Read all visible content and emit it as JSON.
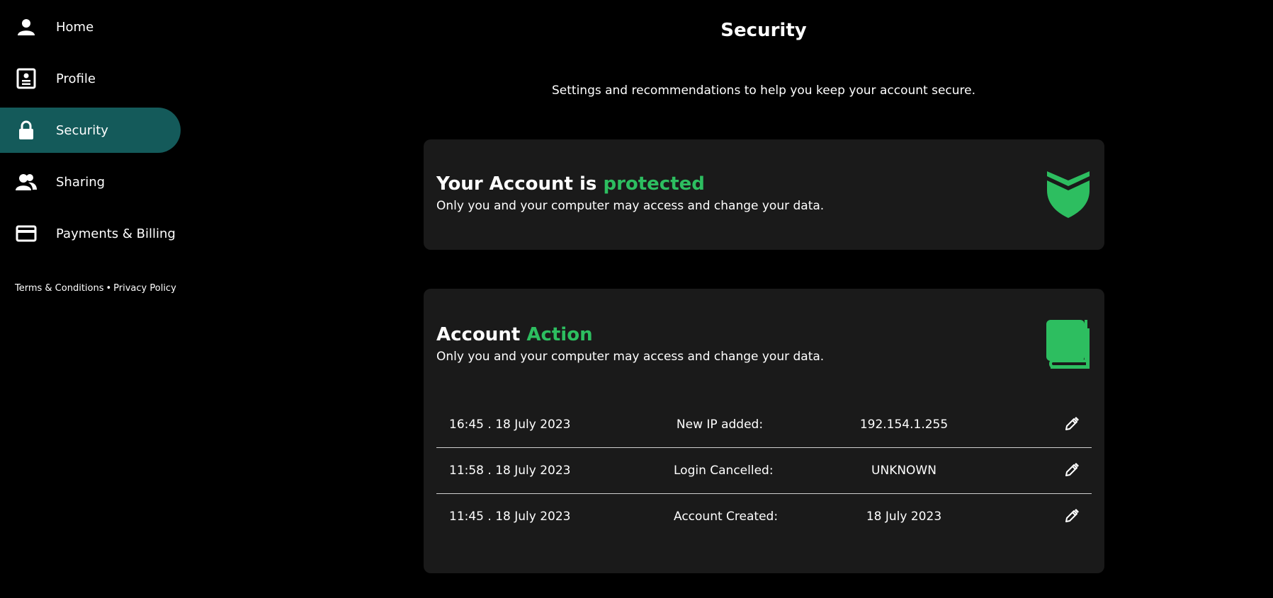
{
  "sidebar": {
    "items": [
      {
        "label": "Home",
        "icon": "user-icon",
        "active": false
      },
      {
        "label": "Profile",
        "icon": "profile-card-icon",
        "active": false
      },
      {
        "label": "Security",
        "icon": "lock-icon",
        "active": true
      },
      {
        "label": "Sharing",
        "icon": "users-icon",
        "active": false
      },
      {
        "label": "Payments & Billing",
        "icon": "credit-card-icon",
        "active": false
      }
    ],
    "footer": {
      "terms": "Terms & Conditions",
      "separator": "•",
      "privacy": "Privacy Policy"
    }
  },
  "page": {
    "title": "Security",
    "subtitle": "Settings and recommendations to help you keep your account secure."
  },
  "status_card": {
    "heading_prefix": "Your Account is",
    "heading_accent": "protected",
    "description": "Only you and your computer may access and change your data.",
    "icon": "shield-icon"
  },
  "actions_card": {
    "heading_prefix": "Account",
    "heading_accent": "Action",
    "description": "Only you and your computer may access and change your data.",
    "icon": "book-icon",
    "rows": [
      {
        "time": "16:45 . 18 July 2023",
        "action": "New IP added:",
        "value": "192.154.1.255"
      },
      {
        "time": "11:58 . 18 July 2023",
        "action": "Login Cancelled:",
        "value": "UNKNOWN"
      },
      {
        "time": "11:45 . 18 July 2023",
        "action": "Account Created:",
        "value": "18 July 2023"
      }
    ]
  },
  "colors": {
    "background": "#000000",
    "card": "#1a1a1a",
    "accent": "#2dbe60",
    "active_nav": "#145a5a"
  }
}
